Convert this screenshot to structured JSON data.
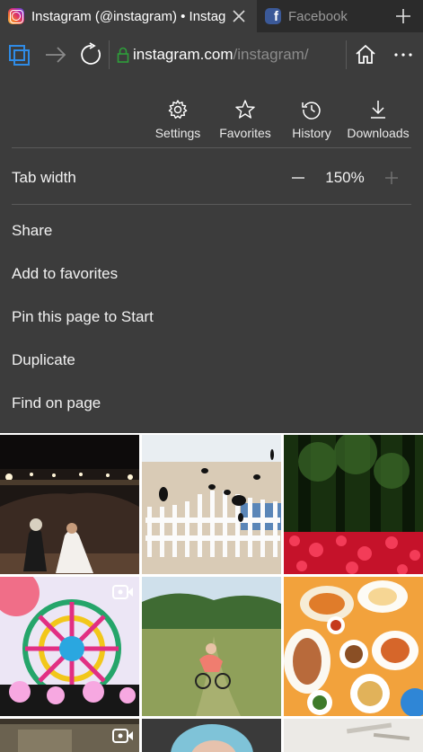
{
  "tabs": [
    {
      "title": "Instagram (@instagram) • Instagram photos and videos",
      "favicon": "instagram-icon",
      "active": true
    },
    {
      "title": "Facebook",
      "favicon": "facebook-icon",
      "active": false
    }
  ],
  "address": {
    "host": "instagram.com",
    "path": "/instagram/"
  },
  "quick_actions": [
    {
      "label": "Settings",
      "icon": "gear-icon"
    },
    {
      "label": "Favorites",
      "icon": "star-icon"
    },
    {
      "label": "History",
      "icon": "history-icon"
    },
    {
      "label": "Downloads",
      "icon": "download-icon"
    }
  ],
  "zoom": {
    "label": "Tab width",
    "value": "150%",
    "decrease": "—",
    "increase": "+"
  },
  "menu_items": [
    "Share",
    "Add to favorites",
    "Pin this page to Start",
    "Duplicate",
    "Find on page"
  ],
  "colors": {
    "chrome": "#3c3c3c",
    "tabbar": "#2b2b2b",
    "lock": "#2e9e3a",
    "text": "#f2f2f2"
  }
}
